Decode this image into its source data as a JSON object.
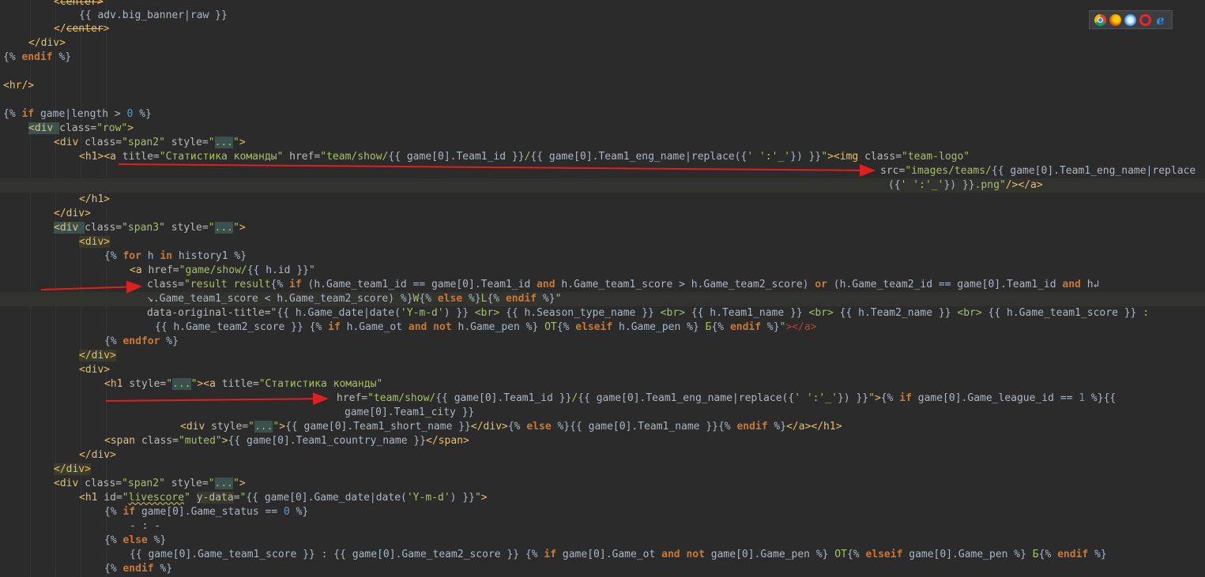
{
  "browser_icons": [
    "chrome-icon",
    "firefox-icon",
    "safari-icon",
    "opera-icon",
    "ie-icon"
  ],
  "colors": {
    "background": "#2b2b2b",
    "tag": "#e8bf6a",
    "string": "#a5c261",
    "keyword": "#cc7832",
    "number": "#6897bb",
    "text": "#a9b7c6",
    "arrow": "#e02020"
  },
  "code": {
    "l1": "center>",
    "l2": "{{ adv.big_banner|raw }}",
    "l3": [
      "</",
      "center",
      ">"
    ],
    "l4": "</div>",
    "l5": [
      "{% ",
      "endif",
      " %}"
    ],
    "l7": "<hr/>",
    "l9": [
      "{% ",
      "if",
      " game|length > ",
      "0",
      " %}"
    ],
    "l10": [
      "<div ",
      "class=",
      "\"row\"",
      ">"
    ],
    "l11": [
      "<div ",
      "class=",
      "\"span2\"",
      " style=",
      "\"",
      "...",
      "\"",
      ">"
    ],
    "l12": [
      "<h1>",
      "<a ",
      "title=",
      "\"Статистика команды\"",
      " href=",
      "\"team/show/",
      "{{ game[0].Team1_id }}",
      "/",
      "{{ game[0].Team1_eng_name|replace({",
      "' ':'_'",
      "}) }}",
      "\"",
      "><img ",
      "class=",
      "\"team-logo\""
    ],
    "l13": [
      "src=",
      "\"images/teams/",
      "{{ game[0].Team1_eng_name|replace"
    ],
    "l14": [
      "({",
      "' ':'_'",
      "}) }}",
      ".png\"",
      "/></a>"
    ],
    "l15": "</h1>",
    "l16": "</div>",
    "l17": [
      "<div ",
      "class=",
      "\"span3\"",
      " style=",
      "\"",
      "...",
      "\"",
      ">"
    ],
    "l18": "<div>",
    "l19": [
      "{% ",
      "for",
      " h ",
      "in",
      " history1 %}"
    ],
    "l20": [
      "<a ",
      "href=",
      "\"game/show/",
      "{{ h.id }}",
      "\""
    ],
    "l21": [
      "class=",
      "\"",
      "result result",
      "{% ",
      "if",
      " (h.Game_team1_id == game[0].Team1_id ",
      "and",
      " h.Game_team1_score > h.Game_team2_score) ",
      "or",
      " (h.Game_team2_id == game[0].Team1_id ",
      "and",
      " h",
      "↲"
    ],
    "l22": [
      "↘.Game_team1_score < h.Game_team2_score) %}",
      "W",
      "{% ",
      "else",
      " %}",
      "L",
      "{% ",
      "endif",
      " %}",
      "\""
    ],
    "l23": [
      "data-original-title=",
      "\"",
      "{{ h.Game_date|date(",
      "'Y-m-d'",
      ") }}",
      " <br> ",
      "{{ h.Season_type_name }}",
      " <br> ",
      "{{ h.Team1_name }}",
      " <br> ",
      "{{ h.Team2_name }}",
      " <br> ",
      "{{ h.Game_team1_score }}",
      " :"
    ],
    "l24": [
      "{{ h.Game_team2_score }}",
      " ",
      "{% ",
      "if",
      " h.Game_ot ",
      "and not",
      " h.Game_pen %}",
      " ОТ",
      "{% ",
      "elseif",
      " h.Game_pen %}",
      " Б",
      "{% ",
      "endif",
      " %}",
      "\"",
      "></a>"
    ],
    "l25": [
      "{% ",
      "endfor",
      " %}"
    ],
    "l26": "</div>",
    "l27": "<div>",
    "l28": [
      "<h1 ",
      "style=",
      "\"",
      "...",
      "\"",
      "><a ",
      "title=",
      "\"Статистика команды\""
    ],
    "l29": [
      "href=",
      "\"team/show/",
      "{{ game[0].Team1_id }}",
      "/",
      "{{ game[0].Team1_eng_name|replace({",
      "' ':'_'",
      "}) }}",
      "\"",
      ">",
      "{% ",
      "if",
      " game[0].Game_league_id == ",
      "1",
      " %}",
      "{{"
    ],
    "l30": "game[0].Team1_city }}",
    "l31": [
      "<div ",
      "style=",
      "\"",
      "...",
      "\"",
      ">",
      "{{ game[0].Team1_short_name }}",
      "</div>",
      "{% ",
      "else",
      " %}",
      "{{ game[0].Team1_name }}",
      "{% ",
      "endif",
      " %}",
      "</a></h1>"
    ],
    "l32": [
      "<span ",
      "class=",
      "\"muted\"",
      ">",
      "{{ game[0].Team1_country_name }}",
      "</span>"
    ],
    "l33": "</div>",
    "l34": "</div>",
    "l35": [
      "<div ",
      "class=",
      "\"span2\"",
      " style=",
      "\"",
      "...",
      "\"",
      ">"
    ],
    "l36": [
      "<h1 ",
      "id=",
      "\"",
      "livescore",
      "\"",
      " ",
      "y-data",
      "=",
      "\"",
      "{{ game[0].Game_date|date(",
      "'Y-m-d'",
      ") }}",
      "\"",
      ">"
    ],
    "l37": [
      "{% ",
      "if",
      " game[0].Game_status == ",
      "0",
      " %}"
    ],
    "l38": "- : -",
    "l39": [
      "{% ",
      "else",
      " %}"
    ],
    "l40": [
      "{{ game[0].Game_team1_score }}",
      " : ",
      "{{ game[0].Game_team2_score }}",
      " ",
      "{% ",
      "if",
      " game[0].Game_ot ",
      "and not",
      " game[0].Game_pen %}",
      " ОТ",
      "{% ",
      "elseif",
      " game[0].Game_pen %}",
      " Б",
      "{% ",
      "endif",
      " %}"
    ],
    "l41": [
      "{% ",
      "endif",
      " %}"
    ]
  }
}
